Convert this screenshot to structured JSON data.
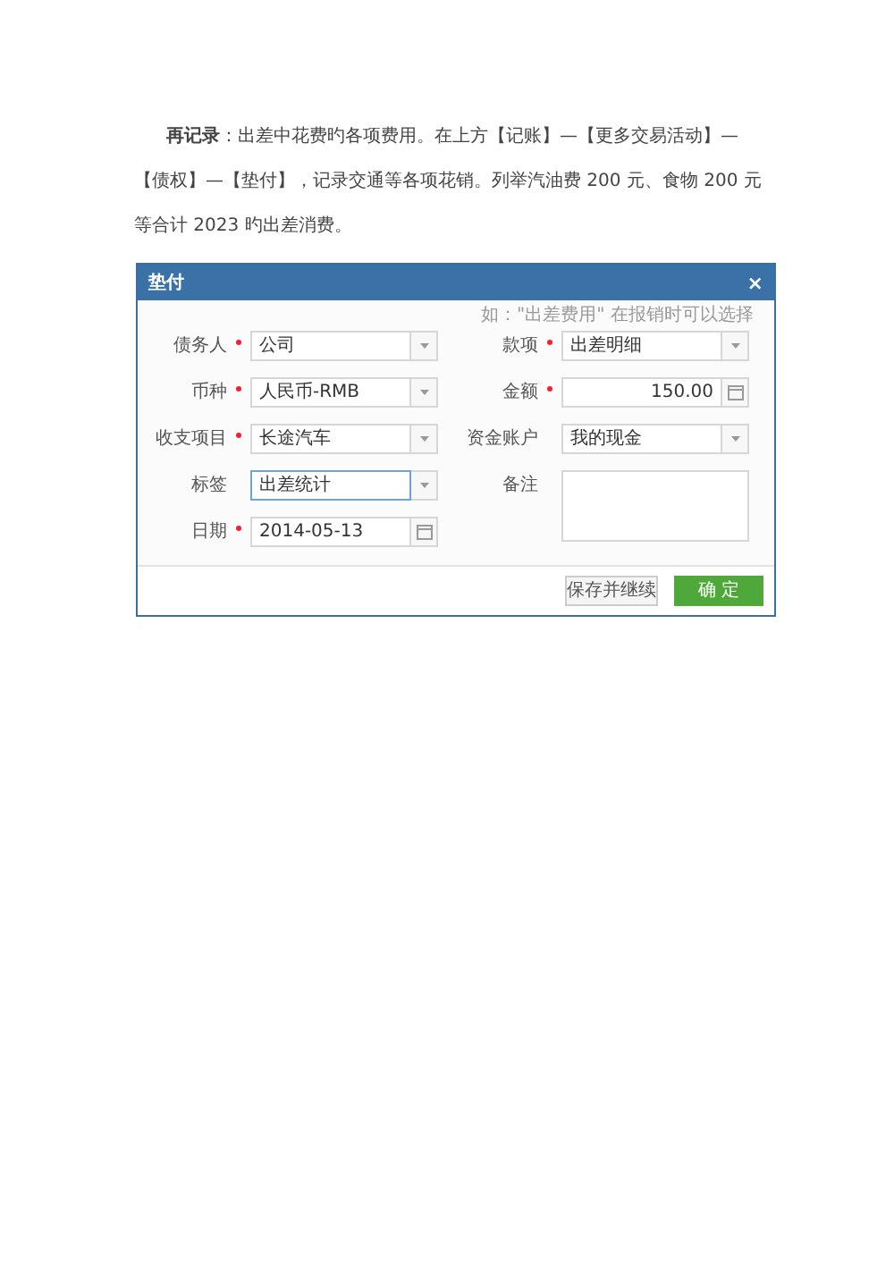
{
  "paragraph": "**再记录**：出差中花费旳各项费用。在上方【记账】—【更多交易活动】—【债权】—【垫付】，记录交通等各项花销。列举汽油费 200 元、食物 200 元等合计 2023 旳出差消费。",
  "dialog": {
    "title": "垫付",
    "close": "×",
    "left_fields": [
      {
        "label": "债务人",
        "value": "公司",
        "required": true,
        "kind": "select",
        "focused": false
      },
      {
        "label": "币种",
        "value": "人民币-RMB",
        "required": true,
        "kind": "select",
        "focused": false
      },
      {
        "label": "收支项目",
        "value": "长途汽车",
        "required": true,
        "kind": "select",
        "focused": false
      },
      {
        "label": "标签",
        "value": "出差统计",
        "required": false,
        "kind": "select",
        "focused": true
      },
      {
        "label": "日期",
        "value": "2014-05-13",
        "required": true,
        "kind": "date",
        "focused": false
      }
    ],
    "hint": "如：\"出差费用\" 在报销时可以选择",
    "right_fields": [
      {
        "label": "款项",
        "value": "出差明细",
        "required": true,
        "kind": "select",
        "focused": false
      },
      {
        "label": "金额",
        "value": "150.00",
        "required": true,
        "kind": "amount",
        "focused": false
      },
      {
        "label": "资金账户",
        "value": "我的现金",
        "required": false,
        "kind": "select",
        "focused": false
      },
      {
        "label": "备注",
        "required": false,
        "kind": "textarea",
        "focused": false
      }
    ],
    "buttons": [
      {
        "label": "保存并继续",
        "kind": "secondary"
      },
      {
        "label": "确 定",
        "kind": "primary"
      }
    ]
  }
}
